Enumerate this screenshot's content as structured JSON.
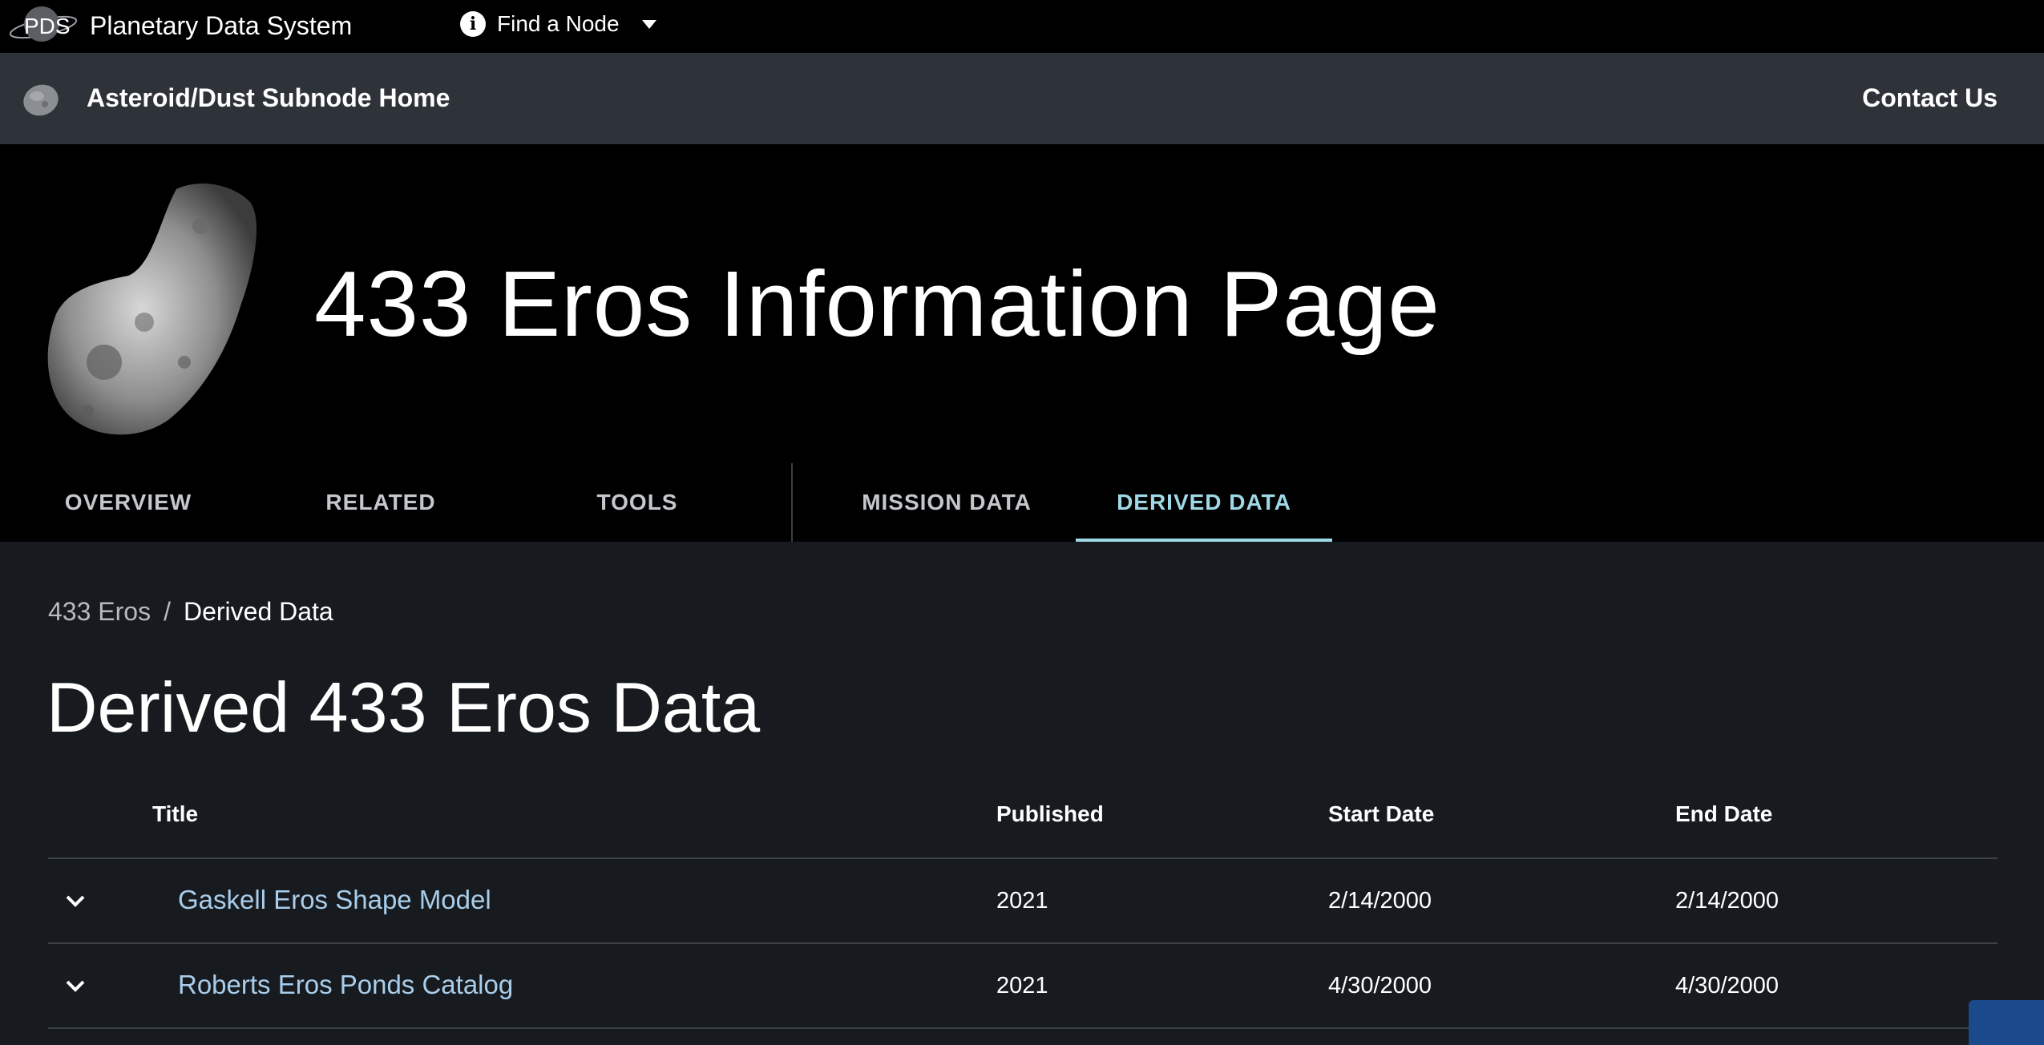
{
  "topbar": {
    "logo_text": "PDS",
    "site_title": "Planetary Data System",
    "find_node_label": "Find a Node"
  },
  "subnav": {
    "home_label": "Asteroid/Dust Subnode Home",
    "contact_label": "Contact Us"
  },
  "hero": {
    "title": "433 Eros Information Page"
  },
  "tabs": [
    {
      "label": "OVERVIEW",
      "active": false
    },
    {
      "label": "RELATED",
      "active": false
    },
    {
      "label": "TOOLS",
      "active": false
    },
    {
      "label": "MISSION DATA",
      "active": false
    },
    {
      "label": "DERIVED DATA",
      "active": true
    }
  ],
  "breadcrumb": {
    "parent": "433 Eros",
    "separator": "/",
    "current": "Derived Data"
  },
  "page": {
    "heading": "Derived 433 Eros Data"
  },
  "table": {
    "columns": [
      "Title",
      "Published",
      "Start Date",
      "End Date"
    ],
    "rows": [
      {
        "title": "Gaskell Eros Shape Model",
        "published": "2021",
        "start": "2/14/2000",
        "end": "2/14/2000"
      },
      {
        "title": "Roberts Eros Ponds Catalog",
        "published": "2021",
        "start": "4/30/2000",
        "end": "4/30/2000"
      }
    ]
  },
  "colors": {
    "accent": "#9fd9e6",
    "link": "#a9cdea",
    "background": "#171b20",
    "subbar": "#2e333a"
  },
  "icons": {
    "find_node": "info-icon",
    "dropdown": "caret-down-icon",
    "row_toggle": "chevron-down-icon"
  }
}
